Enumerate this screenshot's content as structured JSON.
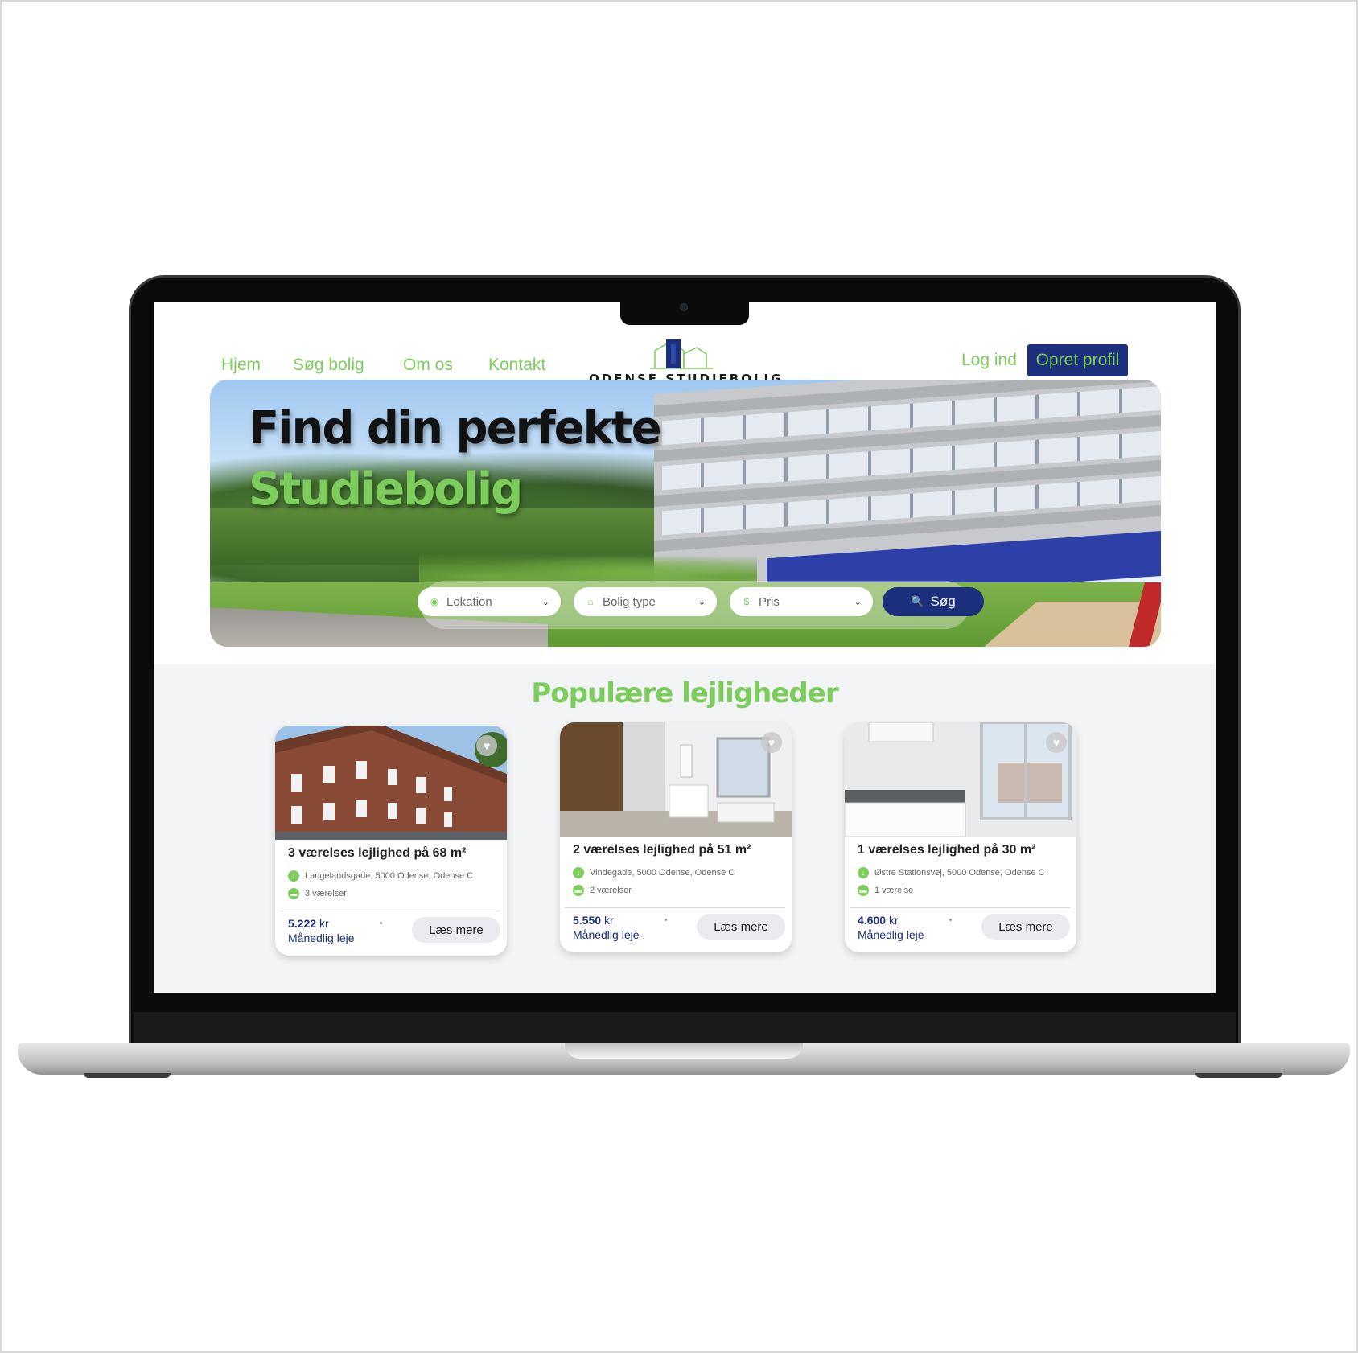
{
  "nav": {
    "items": [
      "Hjem",
      "Søg bolig",
      "Om os",
      "Kontakt"
    ],
    "logo_text": "ODENSE STUDIEBOLIG",
    "login": "Log ind",
    "signup": "Opret profil"
  },
  "hero": {
    "title": "Find din perfekte",
    "subtitle": "Studiebolig",
    "search": {
      "location": "Lokation",
      "type": "Bolig type",
      "price": "Pris",
      "button": "Søg"
    }
  },
  "popular": {
    "title": "Populære lejligheder",
    "cards": [
      {
        "title": "3 værelses lejlighed på 68 m²",
        "address": "Langelandsgade, 5000 Odense, Odense C",
        "rooms": "3 værelser",
        "price": "5.222",
        "currency": "kr",
        "price_label": "Månedlig leje",
        "button": "Læs mere"
      },
      {
        "title": "2 værelses lejlighed på 51 m²",
        "address": "Vindegade, 5000 Odense, Odense C",
        "rooms": "2 værelser",
        "price": "5.550",
        "currency": "kr",
        "price_label": "Månedlig leje",
        "button": "Læs mere"
      },
      {
        "title": "1 værelses lejlighed på 30 m²",
        "address": "Østre Stationsvej, 5000 Odense, Odense C",
        "rooms": "1 værelse",
        "price": "4.600",
        "currency": "kr",
        "price_label": "Månedlig leje",
        "button": "Læs mere"
      }
    ]
  },
  "colors": {
    "accent_green": "#7ccd5b",
    "navy": "#1b2f7d",
    "section_bg": "#f2f4f6"
  },
  "icons": [
    "location-pin-icon",
    "home-icon",
    "dollar-icon",
    "search-icon",
    "heart-icon",
    "address-icon",
    "bed-icon",
    "chevron-down-icon"
  ]
}
